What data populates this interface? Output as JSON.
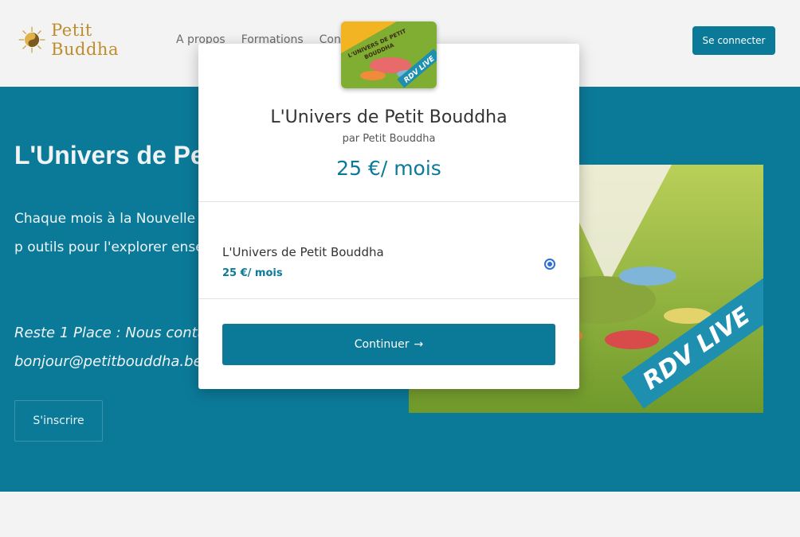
{
  "header": {
    "logo_text": "Petit Buddha",
    "nav": [
      "A propos",
      "Formations",
      "Conta"
    ],
    "login_label": "Se connecter"
  },
  "hero": {
    "title": "L'Univers de Petit Bouddha",
    "text": "Chaque mois à la Nouvelle L d'1H30 autour d'un thème p outils pour l'explorer ensem",
    "note": "Reste 1 Place : Nous contac bonjour@petitbouddha.be",
    "subscribe_label": "S'inscrire",
    "image_banner": "RDV LIVE"
  },
  "modal": {
    "thumb_caption_top": "L'UNIVERS DE PETIT",
    "thumb_caption_sub": "BOUDDHA",
    "thumb_badge": "RDV LIVE",
    "title": "L'Univers de Petit Bouddha",
    "by": "par Petit Bouddha",
    "price": "25 €/ mois",
    "plan_name": "L'Univers de Petit Bouddha",
    "plan_price": "25 €/ mois",
    "continue_label": "Continuer",
    "continue_arrow": "→"
  },
  "colors": {
    "primary": "#0a7a98",
    "hero_bg": "#0b7a99",
    "logo_gold": "#c08c2a"
  }
}
